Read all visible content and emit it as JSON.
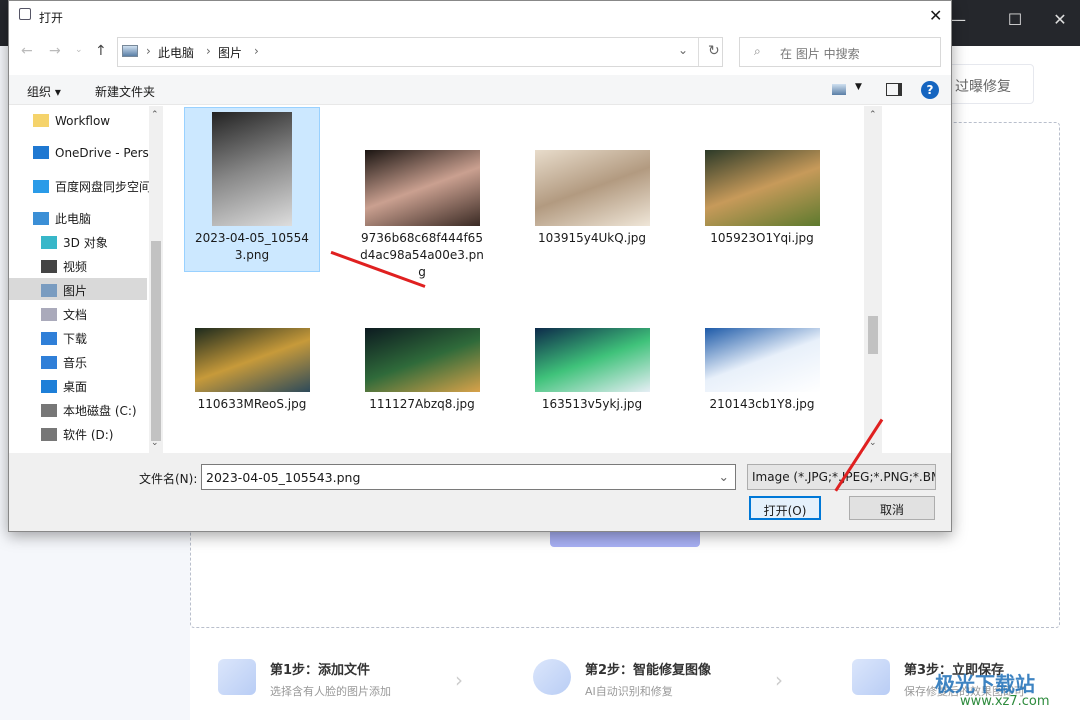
{
  "app": {
    "partial_button": "过曝修复",
    "window_controls": [
      "minimize-icon",
      "maximize-icon",
      "close-icon"
    ],
    "steps": [
      {
        "title": "第1步：添加文件",
        "sub": "选择含有人脸的图片添加"
      },
      {
        "title": "第2步：智能修复图像",
        "sub": "AI自动识别和修复"
      },
      {
        "title": "第3步：立即保存",
        "sub": "保存修复后的效果图即可"
      }
    ],
    "watermark": "极光下载站",
    "watermark_url": "www.xz7.com"
  },
  "dialog": {
    "title": "打开",
    "breadcrumb": [
      "此电脑",
      "图片"
    ],
    "search_placeholder": "在 图片 中搜索",
    "toolbar": {
      "organize": "组织 ▾",
      "new_folder": "新建文件夹"
    },
    "nav": [
      {
        "label": "Workflow",
        "icon": "folder-icon",
        "color": "#f5d36b"
      },
      {
        "label": "OneDrive - Personal",
        "icon": "cloud-icon",
        "color": "#1f78d1"
      },
      {
        "label": "百度网盘同步空间",
        "icon": "baidu-disk-icon",
        "color": "#2a9be8"
      },
      {
        "label": "此电脑",
        "icon": "computer-icon",
        "color": "#3b8fd6"
      },
      {
        "label": "3D 对象",
        "icon": "cube-icon",
        "color": "#38b7c9"
      },
      {
        "label": "视频",
        "icon": "video-icon",
        "color": "#444"
      },
      {
        "label": "图片",
        "icon": "pictures-icon",
        "color": "#7a9cc0",
        "selected": true
      },
      {
        "label": "文档",
        "icon": "document-icon",
        "color": "#aab"
      },
      {
        "label": "下载",
        "icon": "download-icon",
        "color": "#2f7fd8"
      },
      {
        "label": "音乐",
        "icon": "music-icon",
        "color": "#2f7fd8"
      },
      {
        "label": "桌面",
        "icon": "desktop-icon",
        "color": "#1e7fd8"
      },
      {
        "label": "本地磁盘 (C:)",
        "icon": "drive-icon",
        "color": "#777"
      },
      {
        "label": "软件 (D:)",
        "icon": "drive-icon",
        "color": "#777"
      }
    ],
    "files": [
      {
        "name": "2023-04-05_105543.png",
        "selected": true,
        "colors": [
          "#222",
          "#888",
          "#ddd"
        ]
      },
      {
        "name": "9736b68c68f444f65d4ac98a54a00e3.png",
        "colors": [
          "#1b1512",
          "#caa090",
          "#3a2a24"
        ]
      },
      {
        "name": "103915y4UkQ.jpg",
        "colors": [
          "#e8dccb",
          "#b29a80",
          "#efe6d8"
        ]
      },
      {
        "name": "105923O1Yqi.jpg",
        "colors": [
          "#2c3a28",
          "#c79a5a",
          "#5d7a2e"
        ]
      },
      {
        "name": "110633MReoS.jpg",
        "colors": [
          "#1d2a1d",
          "#c79a3a",
          "#2d4a5a"
        ]
      },
      {
        "name": "111127Abzq8.jpg",
        "colors": [
          "#0c1a20",
          "#2f6a3a",
          "#d9a24a"
        ]
      },
      {
        "name": "163513v5ykj.jpg",
        "colors": [
          "#0c2a4a",
          "#3fc27a",
          "#e6eef5"
        ]
      },
      {
        "name": "210143cb1Y8.jpg",
        "colors": [
          "#1d5aa8",
          "#e8f0fa",
          "#fff"
        ]
      }
    ],
    "filename_label": "文件名(N):",
    "filename_value": "2023-04-05_105543.png",
    "filetype": "Image (*.JPG;*.JPEG;*.PNG;*.BMP)",
    "open": "打开(O)",
    "cancel": "取消"
  }
}
